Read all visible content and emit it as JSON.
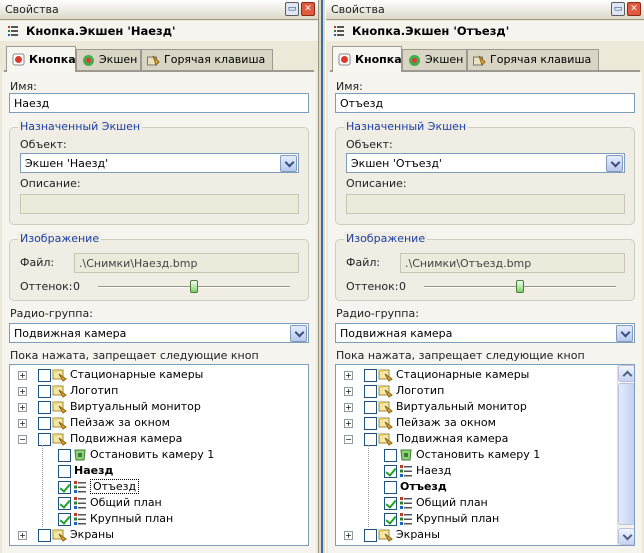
{
  "panes": [
    {
      "title": "Свойства",
      "header": "Кнопка.Экшен 'Наезд'",
      "tabs": [
        "Кнопка",
        "Экшен",
        "Горячая клавиша"
      ],
      "name_label": "Имя:",
      "name_value": "Наезд",
      "action_group": "Назначенный Экшен",
      "object_label": "Объект:",
      "object_value": "Экшен 'Наезд'",
      "description_label": "Описание:",
      "description_value": "",
      "image_group": "Изображение",
      "file_label": "Файл:",
      "file_value": ".\\Снимки\\Наезд.bmp",
      "tint_label": "Оттенок:",
      "tint_value": "0",
      "tint_level": 0.5,
      "radio_label": "Радио-группа:",
      "radio_value": "Подвижная камера",
      "forbid_label": "Пока нажата, запрещает следующие кноп",
      "tree": [
        {
          "text": "Стационарные камеры",
          "level": 0,
          "expander": "+",
          "checked": false,
          "icon": "folder-camera-icon"
        },
        {
          "text": "Логотип",
          "level": 0,
          "expander": "+",
          "checked": false,
          "icon": "folder-camera-icon"
        },
        {
          "text": "Виртуальный монитор",
          "level": 0,
          "expander": "+",
          "checked": false,
          "icon": "folder-camera-icon"
        },
        {
          "text": "Пейзаж за окном",
          "level": 0,
          "expander": "+",
          "checked": false,
          "icon": "folder-camera-icon"
        },
        {
          "text": "Подвижная камера",
          "level": 0,
          "expander": "−",
          "checked": false,
          "icon": "folder-camera-icon"
        },
        {
          "text": "Остановить камеру 1",
          "level": 1,
          "expander": "",
          "checked": false,
          "icon": "camera-stop-icon"
        },
        {
          "text": "Наезд",
          "level": 1,
          "expander": "",
          "checked": false,
          "icon": "",
          "style": "bold"
        },
        {
          "text": "Отъезд",
          "level": 1,
          "expander": "",
          "checked": true,
          "icon": "list-icon",
          "style": "boxed"
        },
        {
          "text": "Общий план",
          "level": 1,
          "expander": "",
          "checked": true,
          "icon": "list-icon"
        },
        {
          "text": "Крупный план",
          "level": 1,
          "expander": "",
          "checked": true,
          "icon": "list-icon"
        },
        {
          "text": "Экраны",
          "level": 0,
          "expander": "+",
          "checked": false,
          "icon": "folder-camera-icon"
        }
      ],
      "has_scrollbar": false
    },
    {
      "title": "Свойства",
      "header": "Кнопка.Экшен 'Отъезд'",
      "tabs": [
        "Кнопка",
        "Экшен",
        "Горячая клавиша"
      ],
      "name_label": "Имя:",
      "name_value": "Отъезд",
      "action_group": "Назначенный Экшен",
      "object_label": "Объект:",
      "object_value": "Экшен 'Отъезд'",
      "description_label": "Описание:",
      "description_value": "",
      "image_group": "Изображение",
      "file_label": "Файл:",
      "file_value": ".\\Снимки\\Отъезд.bmp",
      "tint_label": "Оттенок:",
      "tint_value": "0",
      "tint_level": 0.5,
      "radio_label": "Радио-группа:",
      "radio_value": "Подвижная камера",
      "forbid_label": "Пока нажата, запрещает следующие кноп",
      "tree": [
        {
          "text": "Стационарные камеры",
          "level": 0,
          "expander": "+",
          "checked": false,
          "icon": "folder-camera-icon"
        },
        {
          "text": "Логотип",
          "level": 0,
          "expander": "+",
          "checked": false,
          "icon": "folder-camera-icon"
        },
        {
          "text": "Виртуальный монитор",
          "level": 0,
          "expander": "+",
          "checked": false,
          "icon": "folder-camera-icon"
        },
        {
          "text": "Пейзаж за окном",
          "level": 0,
          "expander": "+",
          "checked": false,
          "icon": "folder-camera-icon"
        },
        {
          "text": "Подвижная камера",
          "level": 0,
          "expander": "−",
          "checked": false,
          "icon": "folder-camera-icon"
        },
        {
          "text": "Остановить камеру 1",
          "level": 1,
          "expander": "",
          "checked": false,
          "icon": "camera-stop-icon"
        },
        {
          "text": "Наезд",
          "level": 1,
          "expander": "",
          "checked": true,
          "icon": "list-icon"
        },
        {
          "text": "Отъезд",
          "level": 1,
          "expander": "",
          "checked": false,
          "icon": "",
          "style": "bold"
        },
        {
          "text": "Общий план",
          "level": 1,
          "expander": "",
          "checked": true,
          "icon": "list-icon"
        },
        {
          "text": "Крупный план",
          "level": 1,
          "expander": "",
          "checked": true,
          "icon": "list-icon"
        },
        {
          "text": "Экраны",
          "level": 0,
          "expander": "+",
          "checked": false,
          "icon": "folder-camera-icon"
        }
      ],
      "has_scrollbar": true
    }
  ],
  "colors": {
    "accent": "#1c3fa0",
    "window_bg": "#ece9d8",
    "divider": "#3a6ea5"
  }
}
